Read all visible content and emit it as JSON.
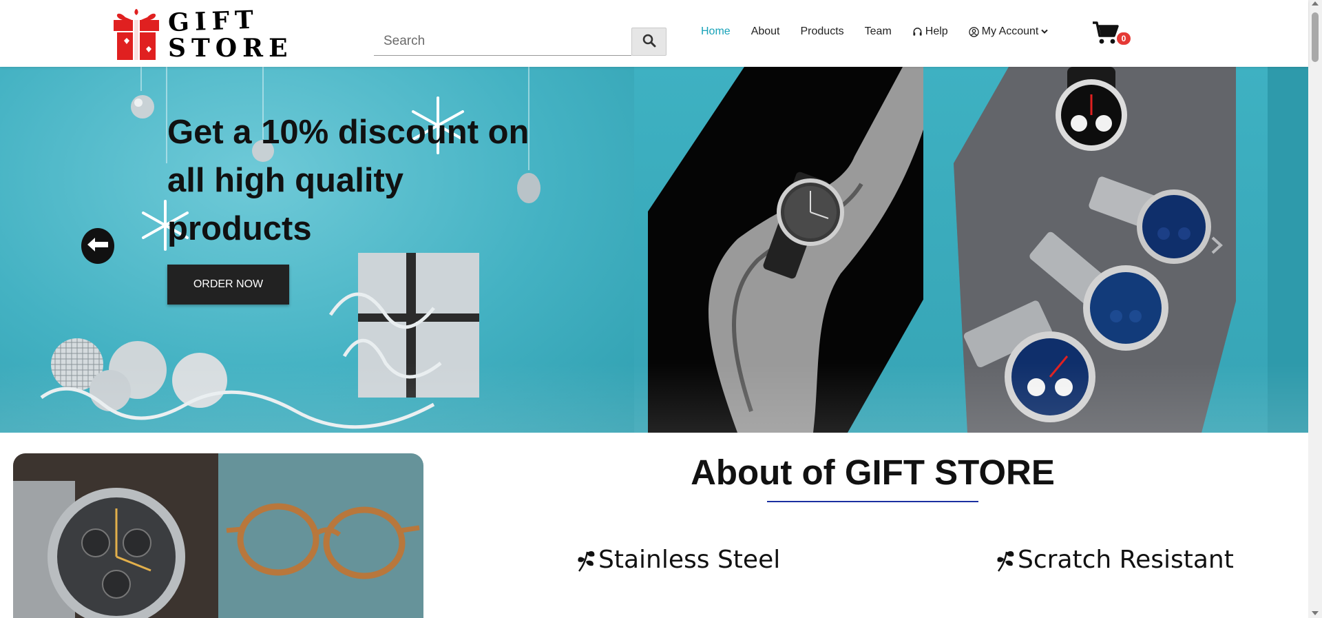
{
  "header": {
    "logo": {
      "line1": "GIFT",
      "line2": "STORE",
      "icon": "gift-box-icon"
    },
    "search": {
      "placeholder": "Search",
      "value": "",
      "button_icon": "search-icon"
    },
    "nav": [
      {
        "label": "Home",
        "active": true
      },
      {
        "label": "About",
        "active": false
      },
      {
        "label": "Products",
        "active": false
      },
      {
        "label": "Team",
        "active": false
      },
      {
        "label": "Help",
        "icon": "headset-icon",
        "active": false
      },
      {
        "label": "My Account",
        "icon": "user-circle-icon",
        "dropdown": true,
        "active": false
      }
    ],
    "cart": {
      "icon": "shopping-cart-icon",
      "count": "0"
    }
  },
  "hero": {
    "title": "Get a 10% discount on all high quality products",
    "cta": "ORDER NOW",
    "prev_icon": "arrow-left-icon",
    "next_icon": "chevron-right-icon"
  },
  "about": {
    "title": "About of GIFT STORE",
    "features": [
      {
        "label": "Stainless Steel",
        "icon": "leaf-icon"
      },
      {
        "label": "Scratch Resistant",
        "icon": "leaf-icon"
      }
    ]
  },
  "colors": {
    "accent": "#17a2b8",
    "hero_bg": "#47b4c5",
    "button_dark": "#222222",
    "badge": "#e53935",
    "underline": "#1a2fa0"
  }
}
